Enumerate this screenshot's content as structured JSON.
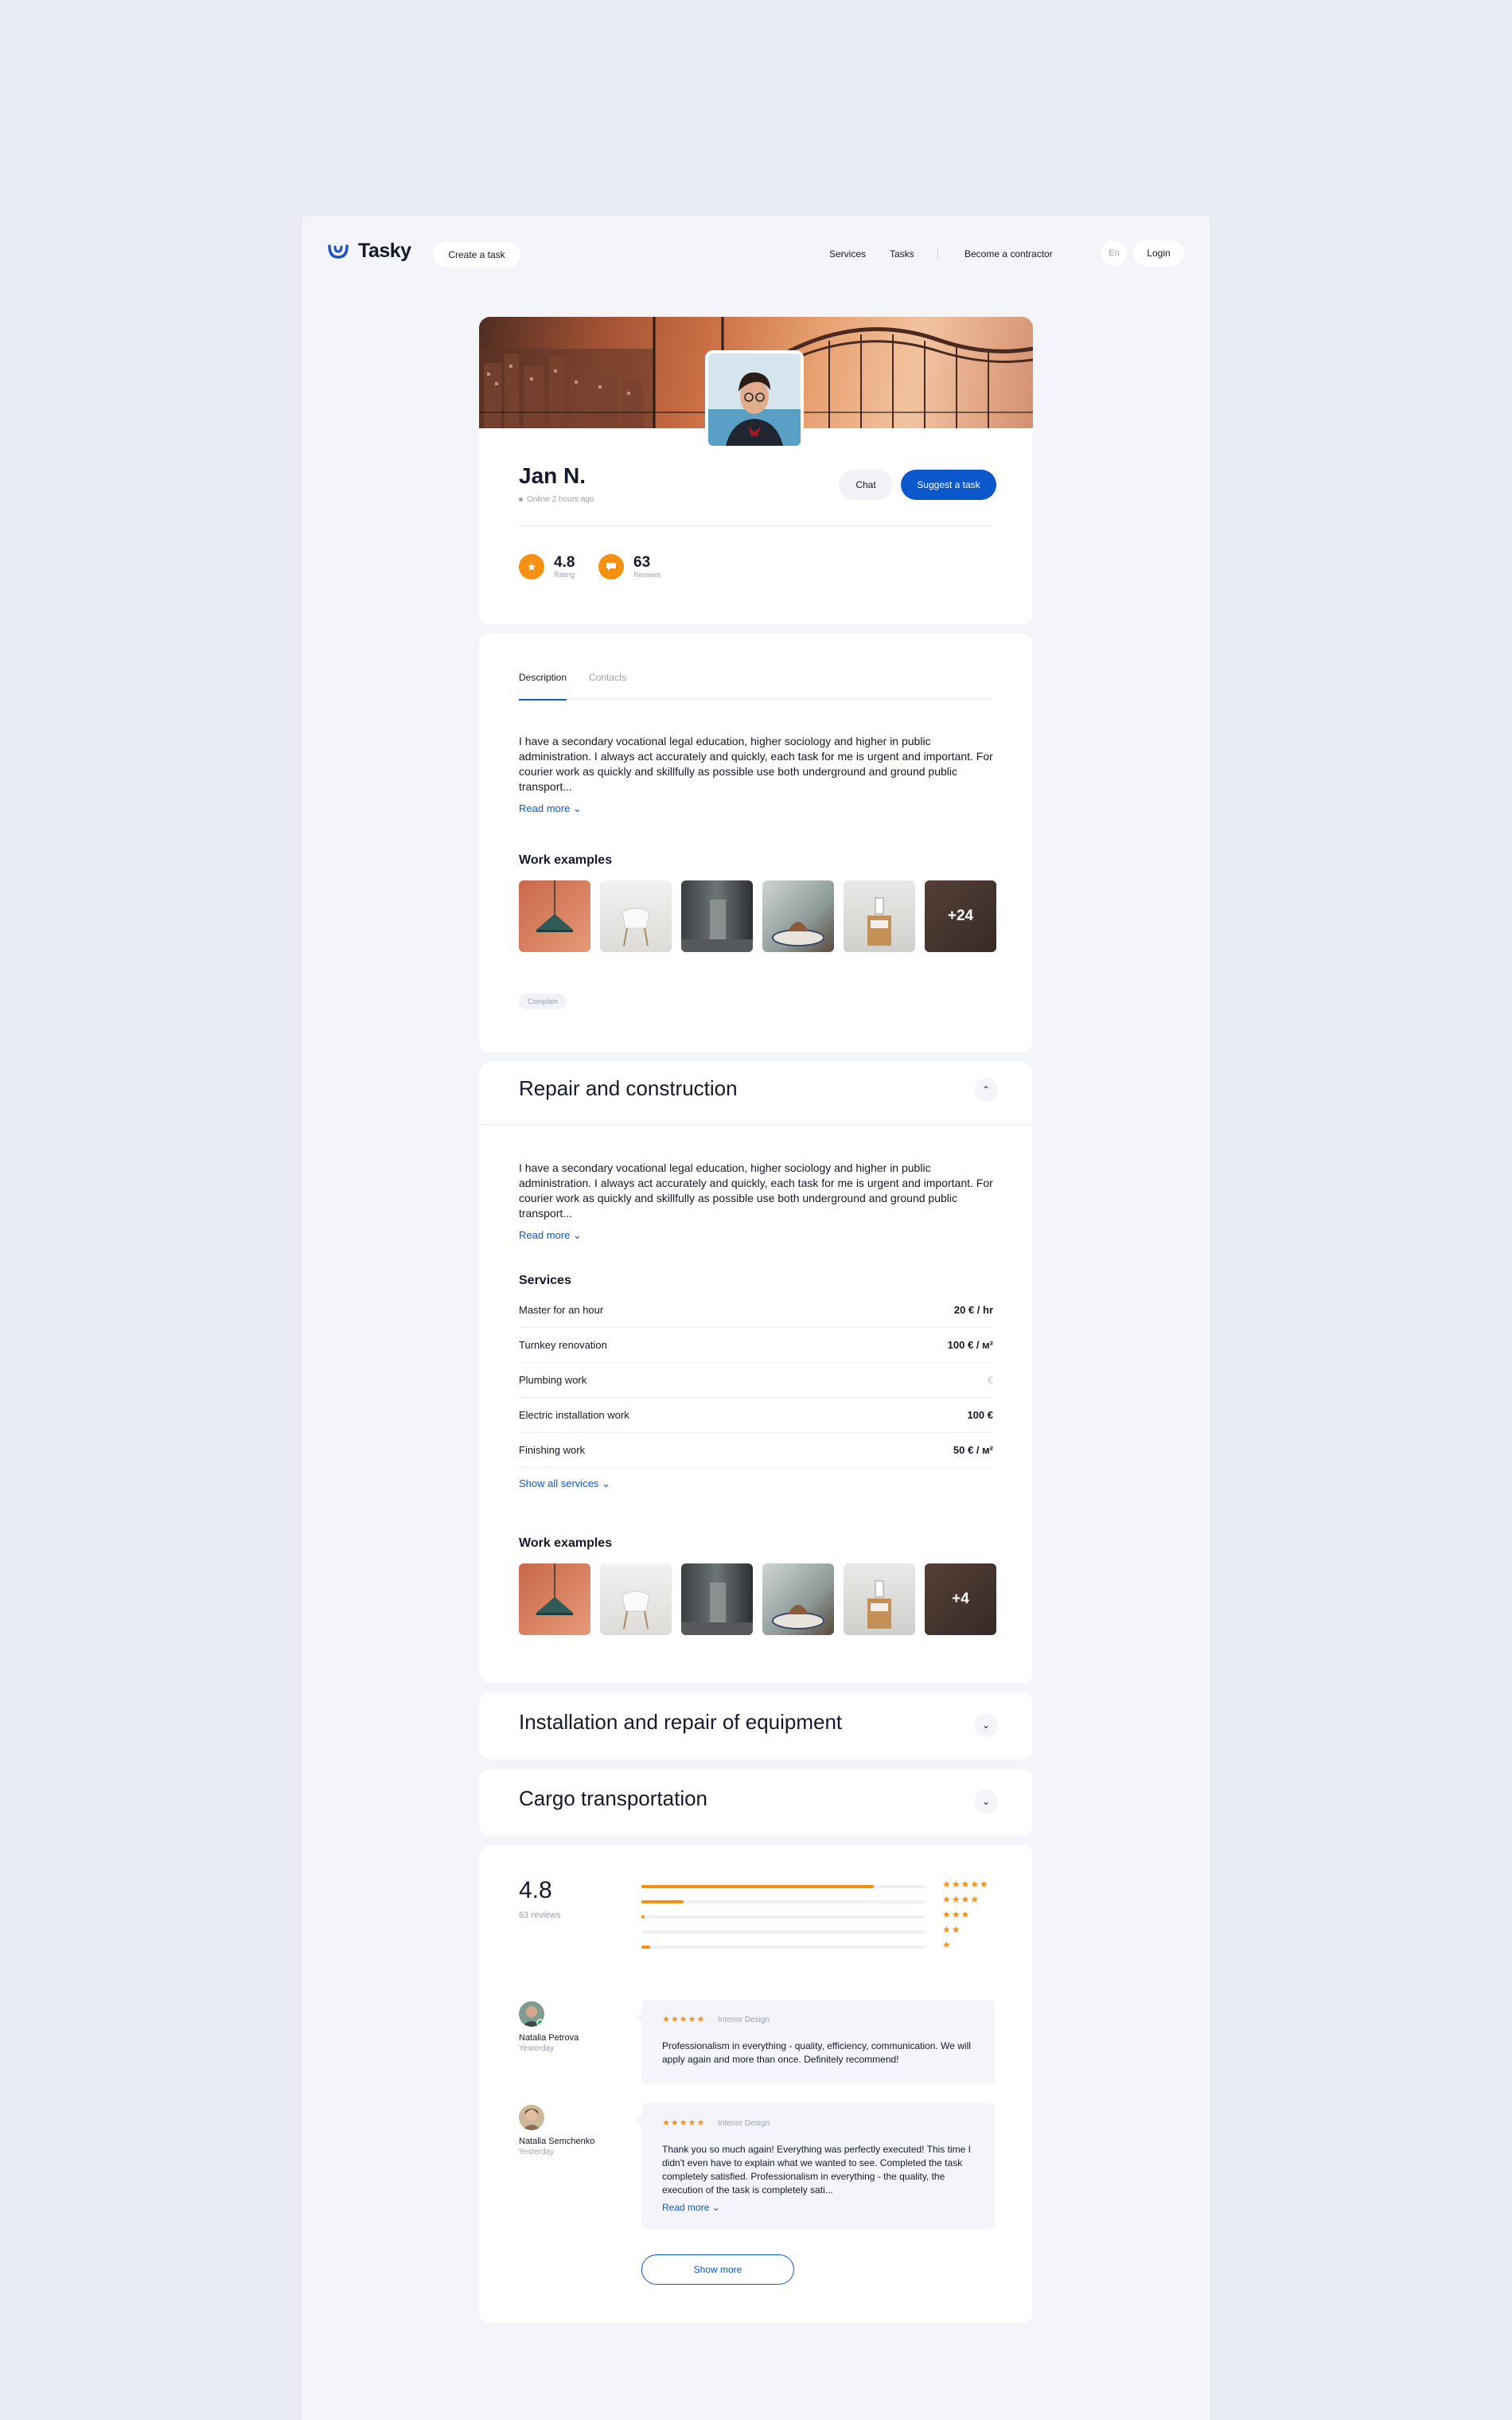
{
  "app": {
    "logo_text": "Tasky"
  },
  "header": {
    "create_task": "Create a task",
    "nav": [
      "Services",
      "Tasks",
      "Become a contractor"
    ],
    "lang": "En",
    "login": "Login"
  },
  "profile": {
    "name": "Jan N.",
    "status": "Online 2 hours ago",
    "chat_label": "Chat",
    "suggest_label": "Suggest a task",
    "rating_value": "4.8",
    "rating_label": "Rating",
    "reviews_value": "63",
    "reviews_label": "Reviews"
  },
  "about": {
    "tabs": [
      "Description",
      "Contacts"
    ],
    "text": "I have a secondary vocational legal education, higher sociology and higher in public administration. I always act accurately and quickly, each task for me is urgent and important. For courier work as quickly and skillfully as possible use both underground and ground public transport...",
    "read_more": "Read more ⌄",
    "work_examples_title": "Work examples",
    "more_count": "+24",
    "complain": "Complain"
  },
  "repair": {
    "title": "Repair and construction",
    "text": "I have a secondary vocational legal education, higher sociology and higher in public administration. I always act accurately and quickly, each task for me is urgent and important. For courier work as quickly and skillfully as possible use both underground and ground public transport...",
    "read_more": "Read more ⌄",
    "services_title": "Services",
    "services": [
      {
        "name": "Master for an hour",
        "price": "20 € / hr"
      },
      {
        "name": "Turnkey renovation",
        "price": "100 € / м²"
      },
      {
        "name": "Plumbing work",
        "price": "€"
      },
      {
        "name": "Electric installation work",
        "price": "100 €"
      },
      {
        "name": "Finishing work",
        "price": "50 € / м²"
      }
    ],
    "show_all": "Show all services ⌄",
    "work_examples_title": "Work examples",
    "more_count": "+4"
  },
  "collapsed_sections": [
    {
      "title": "Installation and repair of equipment"
    },
    {
      "title": "Cargo transportation"
    }
  ],
  "reviews": {
    "rating": "4.8",
    "count_label": "63 reviews",
    "distribution": [
      {
        "stars": "★★★★★",
        "fraction": 0.82
      },
      {
        "stars": "★★★★",
        "fraction": 0.15
      },
      {
        "stars": "★★★",
        "fraction": 0.01
      },
      {
        "stars": "★★",
        "fraction": 0.0
      },
      {
        "stars": "★",
        "fraction": 0.03
      }
    ],
    "items": [
      {
        "name": "Natalia Petrova",
        "date": "Yesterday",
        "stars": "★★★★★",
        "category": "Interior Design",
        "text": "Professionalism in everything - quality, efficiency, communication. We will apply again and more than once. Definitely recommend!"
      },
      {
        "name": "Natalia Semchenko",
        "date": "Yesterday",
        "stars": "★★★★★",
        "category": "Interior Design",
        "text": "Thank you so much again! Everything was perfectly executed! This time I didn't even have to explain what we wanted to see. Completed the task completely satisfied. Professionalism in everything - the quality, the execution of the task is completely sati...",
        "read_more": "Read more ⌄"
      }
    ],
    "show_more": "Show more"
  },
  "colors": {
    "accent": "#0b58cc",
    "rating": "#f49012",
    "background": "#e8ebf2"
  }
}
